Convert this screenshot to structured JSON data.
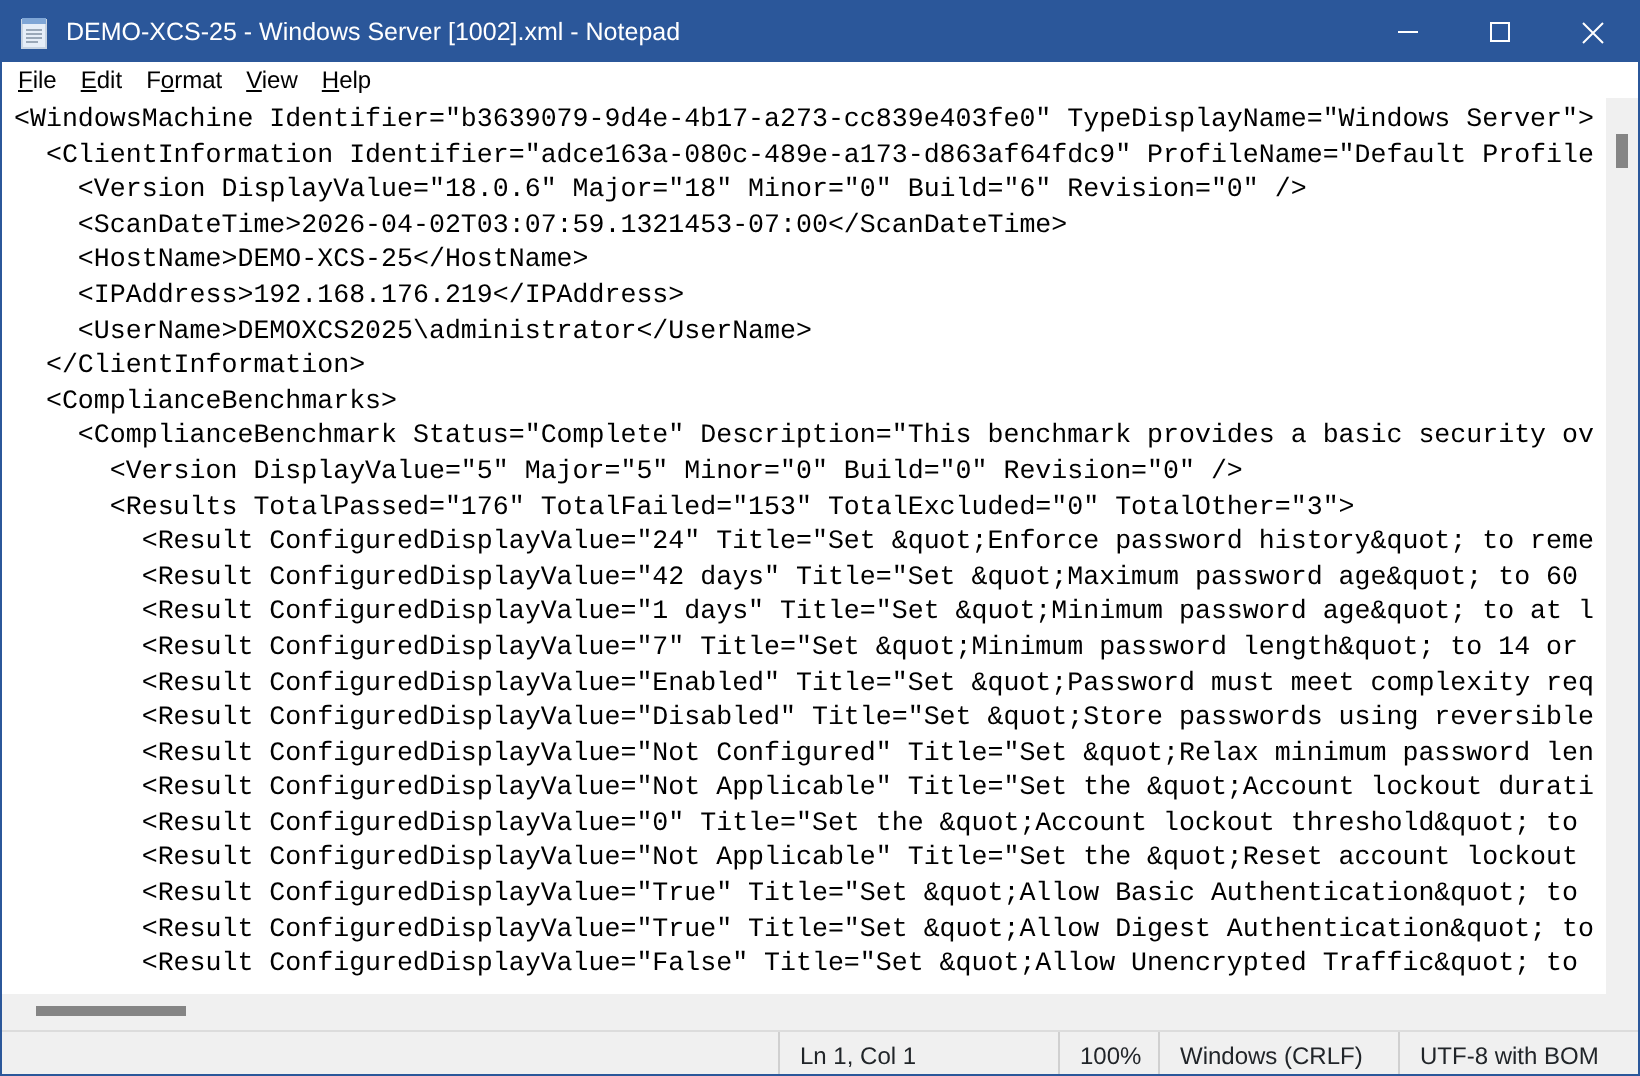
{
  "window": {
    "title": "DEMO-XCS-25 - Windows Server [1002].xml - Notepad"
  },
  "menu": [
    {
      "key": "F",
      "rest": "ile"
    },
    {
      "key": "E",
      "rest": "dit"
    },
    {
      "prefix": "F",
      "key": "o",
      "rest": "rmat"
    },
    {
      "key": "V",
      "rest": "iew"
    },
    {
      "key": "H",
      "rest": "elp"
    }
  ],
  "lines": [
    "<WindowsMachine Identifier=\"b3639079-9d4e-4b17-a273-cc839e403fe0\" TypeDisplayName=\"Windows Server\">",
    "  <ClientInformation Identifier=\"adce163a-080c-489e-a173-d863af64fdc9\" ProfileName=\"Default Profile",
    "    <Version DisplayValue=\"18.0.6\" Major=\"18\" Minor=\"0\" Build=\"6\" Revision=\"0\" />",
    "    <ScanDateTime>2026-04-02T03:07:59.1321453-07:00</ScanDateTime>",
    "    <HostName>DEMO-XCS-25</HostName>",
    "    <IPAddress>192.168.176.219</IPAddress>",
    "    <UserName>DEMOXCS2025\\administrator</UserName>",
    "  </ClientInformation>",
    "  <ComplianceBenchmarks>",
    "    <ComplianceBenchmark Status=\"Complete\" Description=\"This benchmark provides a basic security ov",
    "      <Version DisplayValue=\"5\" Major=\"5\" Minor=\"0\" Build=\"0\" Revision=\"0\" />",
    "      <Results TotalPassed=\"176\" TotalFailed=\"153\" TotalExcluded=\"0\" TotalOther=\"3\">",
    "        <Result ConfiguredDisplayValue=\"24\" Title=\"Set &quot;Enforce password history&quot; to reme",
    "        <Result ConfiguredDisplayValue=\"42 days\" Title=\"Set &quot;Maximum password age&quot; to 60",
    "        <Result ConfiguredDisplayValue=\"1 days\" Title=\"Set &quot;Minimum password age&quot; to at l",
    "        <Result ConfiguredDisplayValue=\"7\" Title=\"Set &quot;Minimum password length&quot; to 14 or",
    "        <Result ConfiguredDisplayValue=\"Enabled\" Title=\"Set &quot;Password must meet complexity req",
    "        <Result ConfiguredDisplayValue=\"Disabled\" Title=\"Set &quot;Store passwords using reversible",
    "        <Result ConfiguredDisplayValue=\"Not Configured\" Title=\"Set &quot;Relax minimum password len",
    "        <Result ConfiguredDisplayValue=\"Not Applicable\" Title=\"Set the &quot;Account lockout durati",
    "        <Result ConfiguredDisplayValue=\"0\" Title=\"Set the &quot;Account lockout threshold&quot; to",
    "        <Result ConfiguredDisplayValue=\"Not Applicable\" Title=\"Set the &quot;Reset account lockout",
    "        <Result ConfiguredDisplayValue=\"True\" Title=\"Set &quot;Allow Basic Authentication&quot; to",
    "        <Result ConfiguredDisplayValue=\"True\" Title=\"Set &quot;Allow Digest Authentication&quot; to",
    "        <Result ConfiguredDisplayValue=\"False\" Title=\"Set &quot;Allow Unencrypted Traffic&quot; to"
  ],
  "status_bar": {
    "position": "Ln 1, Col 1",
    "zoom": "100%",
    "line_endings": "Windows (CRLF)",
    "encoding": "UTF-8 with BOM"
  }
}
